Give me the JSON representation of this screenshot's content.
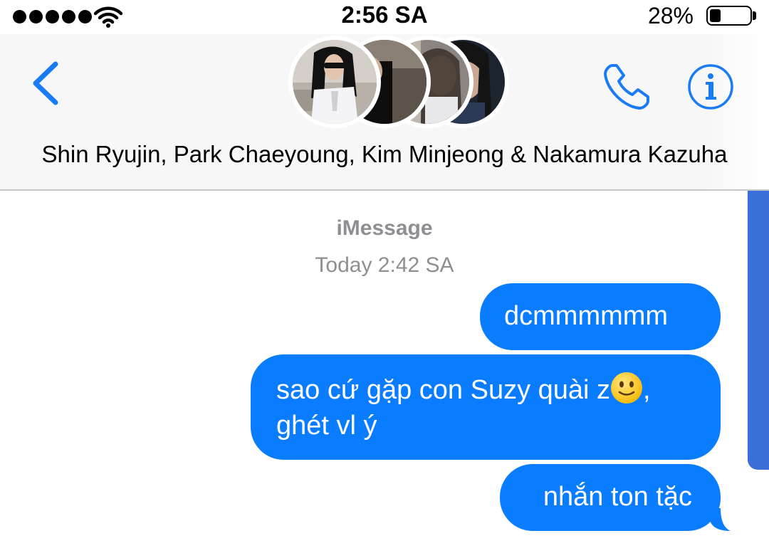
{
  "status_bar": {
    "time": "2:56 SA",
    "battery_percent": "28%",
    "battery_level": 0.28,
    "signal_dots": 5
  },
  "header": {
    "group_name": "Shin Ryujin, Park Chaeyoung, Kim Minjeong & Nakamura Kazuha",
    "icons": [
      "back-chevron-icon",
      "phone-icon",
      "info-icon"
    ],
    "accent_color": "#1a7cf5"
  },
  "conversation": {
    "service_label": "iMessage",
    "timestamp": "Today 2:42 SA",
    "bubble_color": "#0a7cff",
    "messages": [
      {
        "text": "dcmmmmmm"
      },
      {
        "text_line1": "sao cứ gặp con Suzy quài z",
        "emoji": "slightly-smiling-face-emoji",
        "text_line1_end": ",",
        "text_line2": "ghét vl ý"
      },
      {
        "text": "nhắn ton tặc"
      }
    ]
  }
}
